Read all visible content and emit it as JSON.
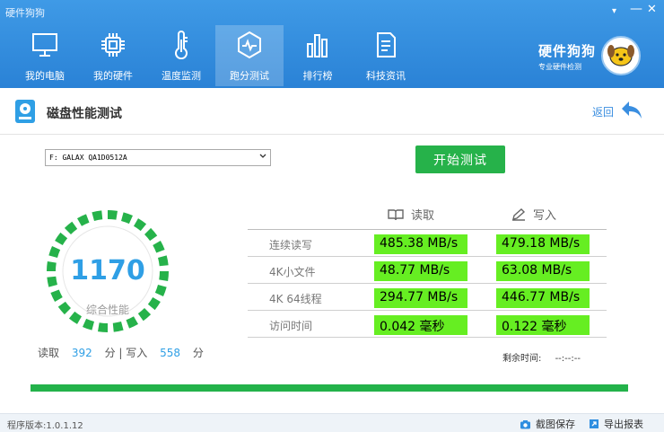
{
  "window": {
    "title": "硬件狗狗",
    "menu": "▾",
    "minimize": "—",
    "close": "✕"
  },
  "nav": [
    {
      "label": "我的电脑",
      "icon": "monitor-icon"
    },
    {
      "label": "我的硬件",
      "icon": "chip-icon"
    },
    {
      "label": "温度监测",
      "icon": "thermometer-icon"
    },
    {
      "label": "跑分测试",
      "icon": "benchmark-icon",
      "active": true
    },
    {
      "label": "排行榜",
      "icon": "bar-chart-icon"
    },
    {
      "label": "科技资讯",
      "icon": "news-icon"
    }
  ],
  "brand": {
    "name": "硬件狗狗",
    "tagline": "专业硬件检测"
  },
  "page": {
    "title": "磁盘性能测试",
    "back": "返回"
  },
  "drive": {
    "selected": "F: GALAX QA1D0512A"
  },
  "start_button": "开始测试",
  "score": {
    "value": "1170",
    "label": "综合性能",
    "progress": 1.0
  },
  "subscores": {
    "read_label": "读取",
    "read_value": "392",
    "unit1": "分",
    "sep": "|",
    "write_label": "写入",
    "write_value": "558",
    "unit2": "分"
  },
  "columns": {
    "read": "读取",
    "write": "写入"
  },
  "rows": [
    {
      "label": "连续读写",
      "read": "485.38 MB/s",
      "write": "479.18 MB/s"
    },
    {
      "label": "4K小文件",
      "read": "48.77 MB/s",
      "write": "63.08 MB/s"
    },
    {
      "label": "4K 64线程",
      "read": "294.77 MB/s",
      "write": "446.77 MB/s"
    },
    {
      "label": "访问时间",
      "read": "0.042 毫秒",
      "write": "0.122 毫秒"
    }
  ],
  "remaining": {
    "label": "剩余时间:",
    "value": "--:--:--"
  },
  "progress": 1.0,
  "footer": {
    "version": "程序版本:1.0.1.12",
    "screenshot": "截图保存",
    "export": "导出报表"
  },
  "colors": {
    "header": "#2f8ee0",
    "accent_green": "#26b24a",
    "highlight": "#66ee22",
    "score_blue": "#2f9fe5"
  }
}
